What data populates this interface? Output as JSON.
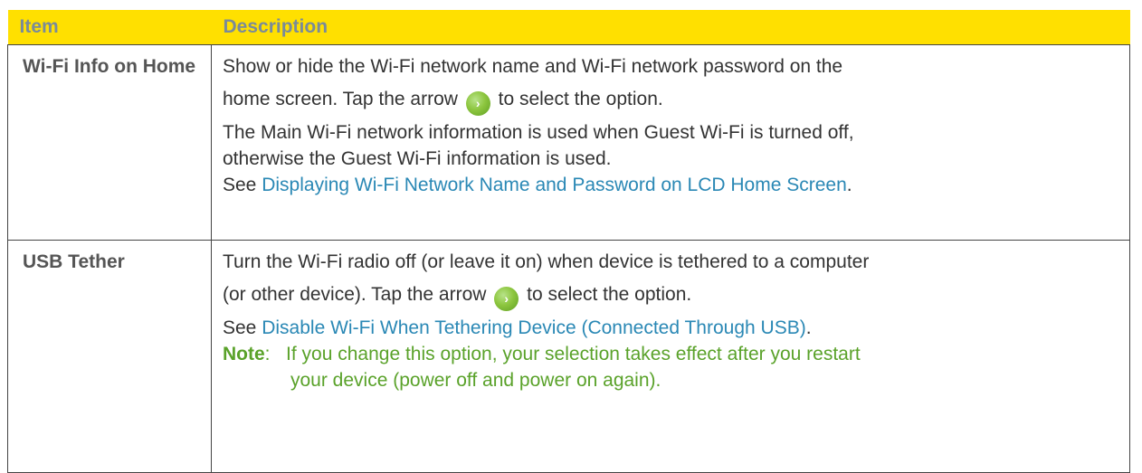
{
  "table": {
    "headers": [
      "Item",
      "Description"
    ],
    "rows": [
      {
        "item": "Wi-Fi Info on Home",
        "lines": [
          "Show or hide the Wi-Fi network name and Wi-Fi network password on the",
          "home screen. Tap the arrow",
          "to select the option.",
          "The Main Wi-Fi network information is used when Guest Wi-Fi is turned off,",
          "otherwise the Guest Wi-Fi information is used.",
          "See",
          "Displaying Wi-Fi Network Name and Password on LCD Home Screen",
          "."
        ]
      },
      {
        "item": "USB Tether",
        "lines": [
          "Turn the Wi-Fi radio off (or leave it on) when device is tethered to a computer",
          "(or other device). Tap the arrow",
          "to select the option.",
          "See",
          "Disable Wi-Fi When Tethering Device (Connected Through USB)",
          "."
        ],
        "note": {
          "label": "Note",
          "colon": ":",
          "line1": "If you change this option, your selection takes effect after you restart",
          "line2": "your device (power off and power on again)."
        }
      }
    ]
  },
  "icons": {
    "arrow": "green-circle-right-arrow-icon",
    "arrow_glyph": "›"
  },
  "colors": {
    "header_bg": "#ffe000",
    "header_text": "#7a8b99",
    "link": "#2a88b5",
    "note": "#5aa22a",
    "arrow": "#8dc63f"
  }
}
